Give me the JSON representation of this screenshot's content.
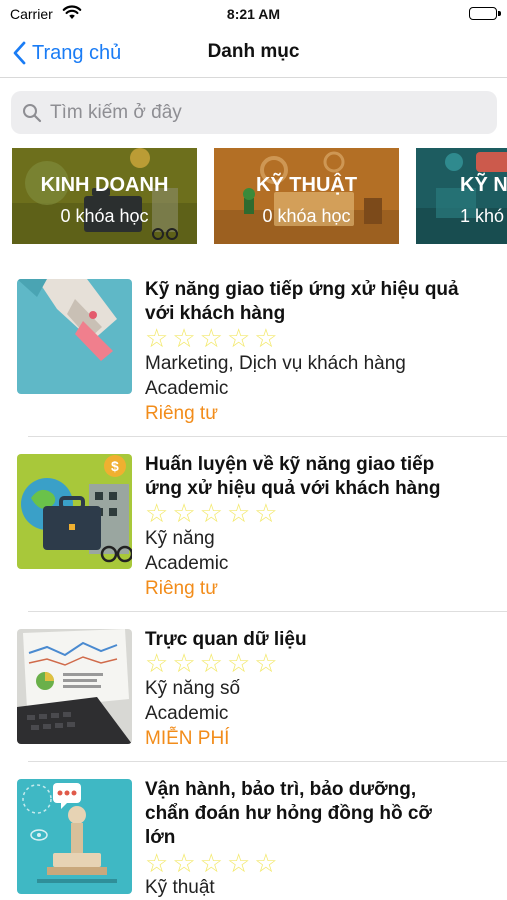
{
  "status_bar": {
    "carrier": "Carrier",
    "time": "8:21 AM",
    "icons": [
      "wifi-icon",
      "battery-icon"
    ]
  },
  "navbar": {
    "back_label": "Trang chủ",
    "title": "Danh mục",
    "accent_color": "#1a7cf5"
  },
  "search": {
    "placeholder": "Tìm kiếm ở đây",
    "value": ""
  },
  "categories": [
    {
      "name": "KINH DOANH",
      "count": "0 khóa học",
      "bg_color": "#7a7a1e"
    },
    {
      "name": "KỸ THUẬT",
      "count": "0 khóa học",
      "bg_color": "#b9772a"
    },
    {
      "name": "KỸ N",
      "count": "1 khó",
      "bg_color": "#1e5f63"
    }
  ],
  "courses": [
    {
      "title_lines": [
        "Kỹ năng giao tiếp ứng xử hiệu quả",
        "với khách hàng"
      ],
      "rating": 0,
      "max_rating": 5,
      "category": "Marketing, Dịch vụ khách hàng",
      "provider": "Academic",
      "privacy": "Riêng tư",
      "thumb": "teal-hand-icon"
    },
    {
      "title_lines": [
        "Huấn luyện về kỹ năng giao tiếp",
        "ứng xử hiệu quả với khách hàng"
      ],
      "rating": 0,
      "max_rating": 5,
      "category": "Kỹ năng",
      "provider": "Academic",
      "privacy": "Riêng tư",
      "thumb": "briefcase-icon"
    },
    {
      "title_lines": [
        "Trực quan dữ liệu"
      ],
      "rating": 0,
      "max_rating": 5,
      "category": "Kỹ năng số",
      "provider": "Academic",
      "privacy": "MIỄN PHÍ",
      "thumb": "report-laptop-icon"
    },
    {
      "title_lines": [
        "Vận hành, bảo trì, bảo dưỡng,",
        "chẩn đoán hư hỏng đồng hồ cỡ",
        "lớn"
      ],
      "rating": 0,
      "max_rating": 5,
      "category": "Kỹ thuật",
      "provider": "",
      "privacy": "",
      "thumb": "stamp-icon"
    }
  ],
  "colors": {
    "privacy_text": "#f28c1a",
    "star_empty": "#f3e96e",
    "divider": "#dedede"
  }
}
